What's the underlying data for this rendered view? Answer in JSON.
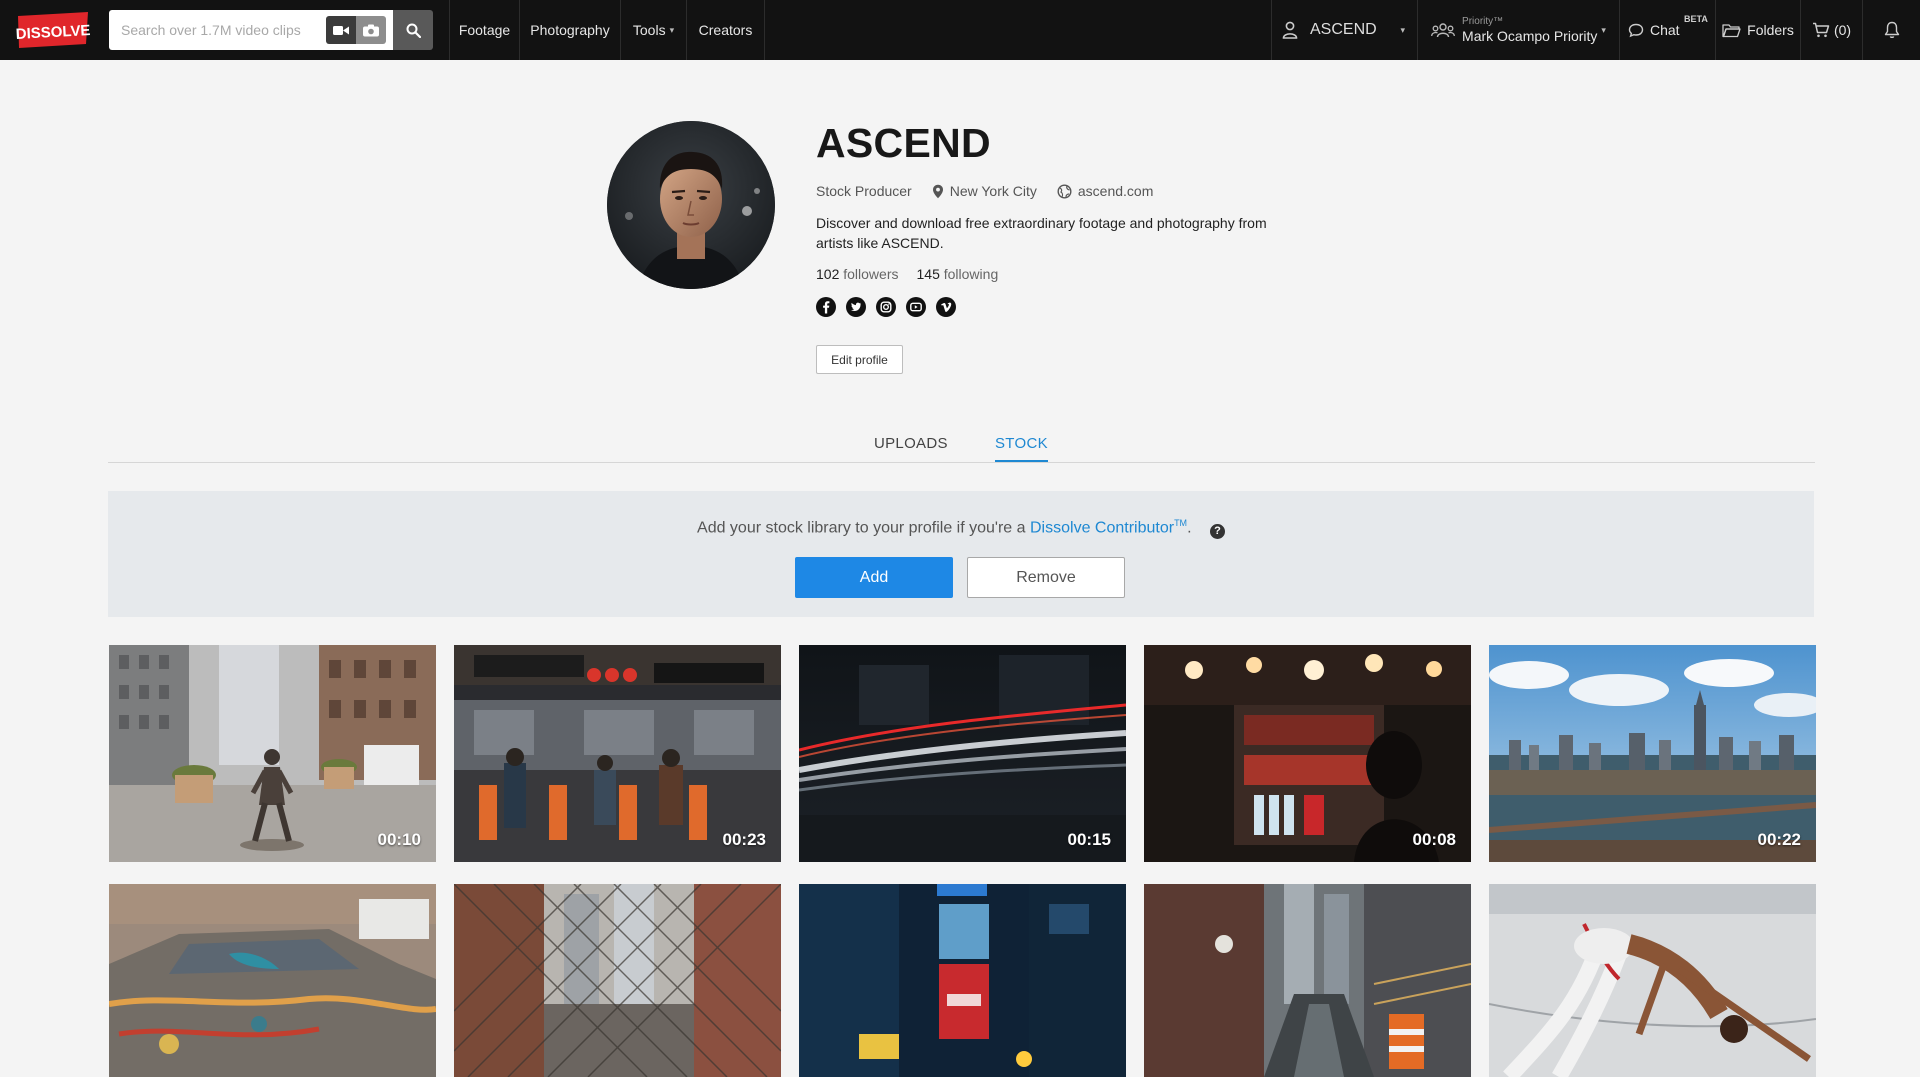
{
  "brand": {
    "logo_text": "DISSOLVE",
    "logo_color": "#e0262b"
  },
  "search": {
    "placeholder": "Search over 1.7M video clips"
  },
  "nav": {
    "items": [
      "Footage",
      "Photography",
      "Tools",
      "Creators"
    ],
    "user": "ASCEND",
    "priority_label": "Priority™",
    "priority_name": "Mark Ocampo Priority",
    "chat": "Chat",
    "beta": "BETA",
    "folders": "Folders",
    "cart": "(0)"
  },
  "profile": {
    "name": "ASCEND",
    "role": "Stock Producer",
    "location": "New York City",
    "website": "ascend.com",
    "bio": "Discover and download free extraordinary footage and photography from artists like ASCEND.",
    "followers_count": "102",
    "followers_label": "followers",
    "following_count": "145",
    "following_label": "following",
    "socials": [
      "facebook",
      "twitter",
      "instagram",
      "youtube",
      "vimeo"
    ],
    "edit_label": "Edit profile"
  },
  "tabs": [
    {
      "label": "UPLOADS",
      "active": false
    },
    {
      "label": "STOCK",
      "active": true
    }
  ],
  "stock_banner": {
    "text_before": "Add your stock library to your profile if you're a",
    "link": "Dissolve Contributor",
    "tm": "TM",
    "text_after": ".",
    "help": "?",
    "add_label": "Add",
    "remove_label": "Remove"
  },
  "accent_color": "#1e88e5",
  "clips": [
    {
      "subject": "fearless girl statue wall street",
      "duration": "00:10"
    },
    {
      "subject": "subway entry turnstiles",
      "duration": "00:23"
    },
    {
      "subject": "long exposure light trails",
      "duration": "00:15"
    },
    {
      "subject": "street food cart at night",
      "duration": "00:08"
    },
    {
      "subject": "aerial manhattan skyline",
      "duration": "00:22"
    },
    {
      "subject": "painted car",
      "duration": ""
    },
    {
      "subject": "street through chain fence",
      "duration": ""
    },
    {
      "subject": "times square billboards",
      "duration": ""
    },
    {
      "subject": "wet city street",
      "duration": ""
    },
    {
      "subject": "dancer on rooftop",
      "duration": ""
    }
  ]
}
